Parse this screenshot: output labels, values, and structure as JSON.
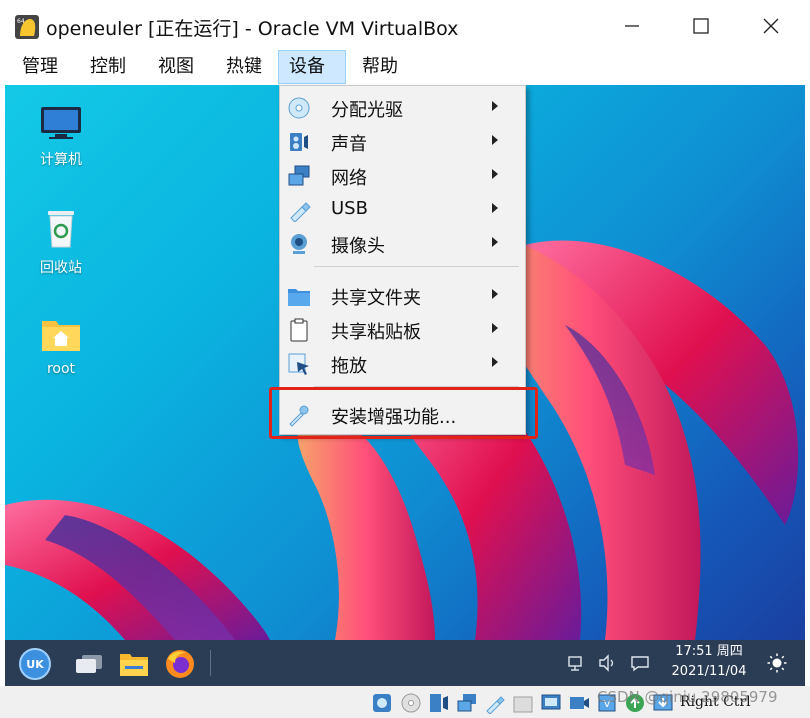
{
  "window": {
    "title": "openeuler [正在运行] - Oracle VM VirtualBox",
    "minimize_icon": "minimize-icon",
    "maximize_icon": "maximize-icon",
    "close_icon": "close-icon"
  },
  "menubar": {
    "items": [
      {
        "label": "管理"
      },
      {
        "label": "控制"
      },
      {
        "label": "视图"
      },
      {
        "label": "热键"
      },
      {
        "label": "设备",
        "active": true
      },
      {
        "label": "帮助"
      }
    ]
  },
  "devices_menu": {
    "items": [
      {
        "label": "分配光驱",
        "icon": "optical-disc-icon",
        "submenu": true
      },
      {
        "label": "声音",
        "icon": "audio-icon",
        "submenu": true
      },
      {
        "label": "网络",
        "icon": "network-icon",
        "submenu": true
      },
      {
        "label": "USB",
        "icon": "usb-icon",
        "submenu": true
      },
      {
        "label": "摄像头",
        "icon": "webcam-icon",
        "submenu": true
      },
      {
        "label": "共享文件夹",
        "icon": "shared-folder-icon",
        "submenu": true
      },
      {
        "label": "共享粘贴板",
        "icon": "clipboard-icon",
        "submenu": true
      },
      {
        "label": "拖放",
        "icon": "drag-drop-icon",
        "submenu": true
      },
      {
        "label": "安装增强功能...",
        "icon": "guest-additions-icon",
        "submenu": false,
        "highlighted": true
      }
    ]
  },
  "desktop": {
    "icons": [
      {
        "label": "计算机",
        "icon": "computer-icon"
      },
      {
        "label": "回收站",
        "icon": "trash-icon"
      },
      {
        "label": "root",
        "icon": "home-folder-icon"
      }
    ]
  },
  "taskbar": {
    "apps": [
      "start-menu-icon",
      "multitask-view-icon",
      "file-manager-icon",
      "firefox-icon"
    ],
    "tray": [
      "network-tray-icon",
      "volume-tray-icon",
      "notification-tray-icon",
      "night-mode-icon"
    ],
    "clock": {
      "time": "17:51 周四",
      "date": "2021/11/04"
    }
  },
  "statusbar": {
    "host_key": "Right Ctrl",
    "watermark": "CSDN @qiniu 29805979"
  },
  "colors": {
    "menu_active": "#cde8ff",
    "highlight_border": "#e2231a",
    "taskbar": "#2b3d55"
  }
}
